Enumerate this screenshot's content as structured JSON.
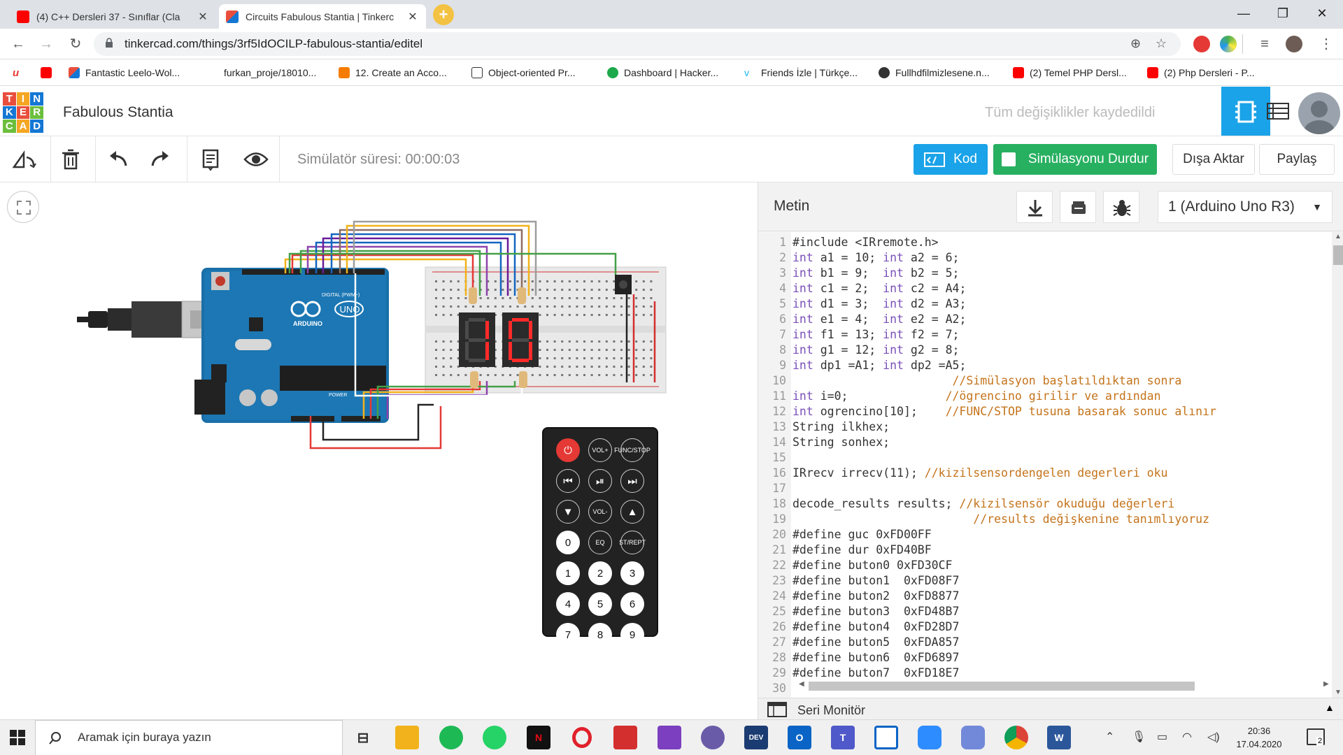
{
  "browser": {
    "tabs": [
      {
        "title": "(4) C++ Dersleri 37 - Sınıflar (Cla",
        "active": false,
        "favicon": "youtube-icon"
      },
      {
        "title": "Circuits Fabulous Stantia | Tinkerc",
        "active": true,
        "favicon": "tinkercad-icon"
      }
    ],
    "new_tab": "+",
    "url": "tinkercad.com/things/3rf5IdOCILP-fabulous-stantia/editel",
    "bookmarks": [
      {
        "label": "Fantastic Leelo-Wol...",
        "icon": "tinkercad-icon"
      },
      {
        "label": "furkan_proje/18010...",
        "icon": "github-icon"
      },
      {
        "label": "12. Create an Acco...",
        "icon": "blogger-icon"
      },
      {
        "label": "Object-oriented Pr...",
        "icon": "hackerrank-icon"
      },
      {
        "label": "Dashboard | Hacker...",
        "icon": "hackerrank-icon"
      },
      {
        "label": "Friends İzle | Türkçe...",
        "icon": "vimeo-icon"
      },
      {
        "label": "Fullhdfilmizlesene.n...",
        "icon": "film-icon"
      },
      {
        "label": "(2) Temel PHP Dersl...",
        "icon": "youtube-icon"
      },
      {
        "label": "(2) Php Dersleri - P...",
        "icon": "youtube-icon"
      }
    ]
  },
  "app": {
    "logo_letters": [
      "T",
      "I",
      "N",
      "K",
      "E",
      "R",
      "C",
      "A",
      "D"
    ],
    "title": "Fabulous Stantia",
    "saved_status": "Tüm değişiklikler kaydedildi"
  },
  "toolbar": {
    "sim_time": "Simülatör süresi: 00:00:03",
    "code_label": "Kod",
    "sim_label": "Simülasyonu Durdur",
    "export_label": "Dışa Aktar",
    "share_label": "Paylaş"
  },
  "code_panel": {
    "mode": "Metin",
    "board": "1 (Arduino Uno R3)",
    "serial_monitor": "Seri Monitör",
    "lines": [
      [
        [
          "p",
          "#include <IRremote.h>"
        ]
      ],
      [
        [
          "k",
          "int"
        ],
        [
          "p",
          " a1 = 10; "
        ],
        [
          "k",
          "int"
        ],
        [
          "p",
          " a2 = 6;"
        ]
      ],
      [
        [
          "k",
          "int"
        ],
        [
          "p",
          " b1 = 9;  "
        ],
        [
          "k",
          "int"
        ],
        [
          "p",
          " b2 = 5;"
        ]
      ],
      [
        [
          "k",
          "int"
        ],
        [
          "p",
          " c1 = 2;  "
        ],
        [
          "k",
          "int"
        ],
        [
          "p",
          " c2 = A4;"
        ]
      ],
      [
        [
          "k",
          "int"
        ],
        [
          "p",
          " d1 = 3;  "
        ],
        [
          "k",
          "int"
        ],
        [
          "p",
          " d2 = A3;"
        ]
      ],
      [
        [
          "k",
          "int"
        ],
        [
          "p",
          " e1 = 4;  "
        ],
        [
          "k",
          "int"
        ],
        [
          "p",
          " e2 = A2;"
        ]
      ],
      [
        [
          "k",
          "int"
        ],
        [
          "p",
          " f1 = 13; "
        ],
        [
          "k",
          "int"
        ],
        [
          "p",
          " f2 = 7;"
        ]
      ],
      [
        [
          "k",
          "int"
        ],
        [
          "p",
          " g1 = 12; "
        ],
        [
          "k",
          "int"
        ],
        [
          "p",
          " g2 = 8;"
        ]
      ],
      [
        [
          "k",
          "int"
        ],
        [
          "p",
          " dp1 =A1; "
        ],
        [
          "k",
          "int"
        ],
        [
          "p",
          " dp2 =A5;"
        ]
      ],
      [
        [
          "p",
          "                       "
        ],
        [
          "c",
          "//Simülasyon başlatıldıktan sonra"
        ]
      ],
      [
        [
          "k",
          "int"
        ],
        [
          "p",
          " i=0;              "
        ],
        [
          "c",
          "//ögrencino girilir ve ardından"
        ]
      ],
      [
        [
          "k",
          "int"
        ],
        [
          "p",
          " ogrencino[10];    "
        ],
        [
          "c",
          "//FUNC/STOP tusuna basarak sonuc alınır"
        ]
      ],
      [
        [
          "p",
          "String ilkhex;"
        ]
      ],
      [
        [
          "p",
          "String sonhex;"
        ]
      ],
      [
        [
          "p",
          ""
        ]
      ],
      [
        [
          "p",
          "IRrecv irrecv(11); "
        ],
        [
          "c",
          "//kizilsensordengelen degerleri oku"
        ]
      ],
      [
        [
          "p",
          ""
        ]
      ],
      [
        [
          "p",
          "decode_results results; "
        ],
        [
          "c",
          "//kizilsensör okuduğu değerleri"
        ]
      ],
      [
        [
          "p",
          "                          "
        ],
        [
          "c",
          "//results değişkenine tanımlıyoruz"
        ]
      ],
      [
        [
          "p",
          "#define guc 0xFD00FF"
        ]
      ],
      [
        [
          "p",
          "#define dur 0xFD40BF"
        ]
      ],
      [
        [
          "p",
          "#define buton0 0xFD30CF"
        ]
      ],
      [
        [
          "p",
          "#define buton1  0xFD08F7"
        ]
      ],
      [
        [
          "p",
          "#define buton2  0xFD8877"
        ]
      ],
      [
        [
          "p",
          "#define buton3  0xFD48B7"
        ]
      ],
      [
        [
          "p",
          "#define buton4  0xFD28D7"
        ]
      ],
      [
        [
          "p",
          "#define buton5  0xFDA857"
        ]
      ],
      [
        [
          "p",
          "#define buton6  0xFD6897"
        ]
      ],
      [
        [
          "p",
          "#define buton7  0xFD18E7"
        ]
      ],
      [
        [
          "p",
          ""
        ]
      ]
    ]
  },
  "circuit": {
    "arduino_label": "UNO",
    "arduino_brand": "ARDUINO",
    "digital_label": "DIGITAL (PWM~)",
    "power_label": "POWER",
    "seg_digits": [
      "1",
      "0"
    ],
    "remote_buttons": [
      {
        "label": "",
        "icon": "power-icon"
      },
      {
        "label": "VOL+"
      },
      {
        "label": "FUNC/STOP"
      },
      {
        "label": "",
        "icon": "rewind-icon"
      },
      {
        "label": "",
        "icon": "play-pause-icon"
      },
      {
        "label": "",
        "icon": "fast-forward-icon"
      },
      {
        "label": "",
        "icon": "down-icon"
      },
      {
        "label": "VOL-"
      },
      {
        "label": "",
        "icon": "up-icon"
      },
      {
        "label": "0"
      },
      {
        "label": "EQ"
      },
      {
        "label": "ST/REPT"
      },
      {
        "label": "1"
      },
      {
        "label": "2"
      },
      {
        "label": "3"
      },
      {
        "label": "4"
      },
      {
        "label": "5"
      },
      {
        "label": "6"
      },
      {
        "label": "7"
      },
      {
        "label": "8"
      },
      {
        "label": "9"
      }
    ]
  },
  "taskbar": {
    "search_placeholder": "Aramak için buraya yazın",
    "time": "20:36",
    "date": "17.04.2020",
    "notification_count": "2"
  }
}
